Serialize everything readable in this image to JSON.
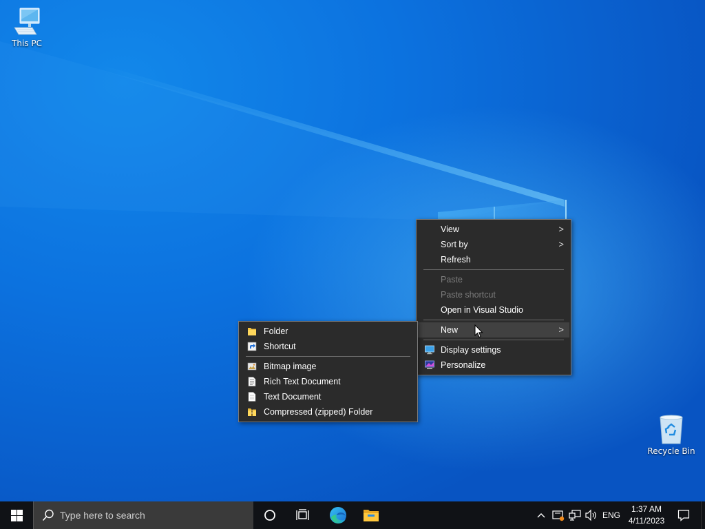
{
  "desktop": {
    "icons": [
      {
        "label": "This PC",
        "icon": "this-pc-icon"
      },
      {
        "label": "Recycle Bin",
        "icon": "recycle-bin-icon"
      }
    ]
  },
  "context_menu": {
    "items": [
      {
        "label": "View",
        "has_submenu": true
      },
      {
        "label": "Sort by",
        "has_submenu": true
      },
      {
        "label": "Refresh"
      },
      {
        "label": "Paste",
        "disabled": true
      },
      {
        "label": "Paste shortcut",
        "disabled": true
      },
      {
        "label": "Open in Visual Studio"
      },
      {
        "label": "New",
        "has_submenu": true,
        "highlighted": true
      },
      {
        "label": "Display settings",
        "icon": "display-settings-icon"
      },
      {
        "label": "Personalize",
        "icon": "personalize-icon"
      }
    ]
  },
  "new_submenu": {
    "items": [
      {
        "label": "Folder",
        "icon": "folder-icon"
      },
      {
        "label": "Shortcut",
        "icon": "shortcut-icon"
      },
      {
        "label": "Bitmap image",
        "icon": "bitmap-icon"
      },
      {
        "label": "Rich Text Document",
        "icon": "rich-text-icon"
      },
      {
        "label": "Text Document",
        "icon": "text-document-icon"
      },
      {
        "label": "Compressed (zipped) Folder",
        "icon": "zip-folder-icon"
      }
    ]
  },
  "taskbar": {
    "search_placeholder": "Type here to search",
    "pinned": [
      "cortana-icon",
      "task-view-icon",
      "edge-icon",
      "file-explorer-icon"
    ],
    "tray": {
      "language": "ENG",
      "time": "1:37 AM",
      "date": "4/11/2023"
    }
  },
  "colors": {
    "menu_bg": "#2b2b2b",
    "menu_hover": "#414141",
    "taskbar_bg": "#101216",
    "desktop_blue": "#0c72df"
  }
}
